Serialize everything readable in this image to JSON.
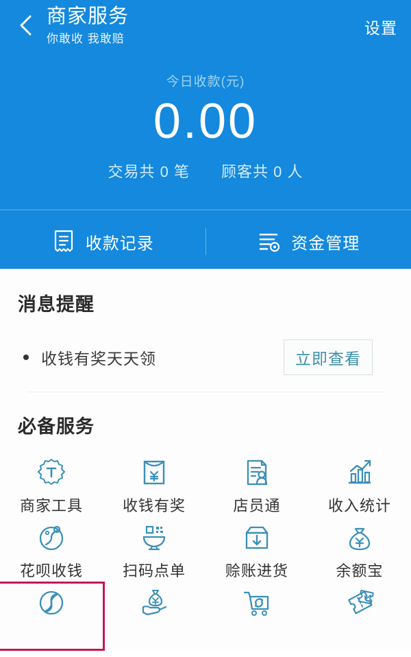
{
  "header": {
    "back_icon": "chevron-left-icon",
    "title": "商家服务",
    "subtitle": "你敢收 我敢赔",
    "settings_label": "设置"
  },
  "summary": {
    "label": "今日收款(元)",
    "amount": "0.00",
    "stats": [
      {
        "text": "交易共 0 笔"
      },
      {
        "text": "顾客共 0 人"
      }
    ]
  },
  "tabs": [
    {
      "label": "收款记录",
      "icon": "receipt-icon"
    },
    {
      "label": "资金管理",
      "icon": "fund-settings-icon"
    }
  ],
  "messages": {
    "heading": "消息提醒",
    "items": [
      {
        "text": "收钱有奖天天领",
        "action_label": "立即查看"
      }
    ]
  },
  "services": {
    "heading": "必备服务",
    "items": [
      {
        "label": "商家工具",
        "icon": "merchant-tool-badge-icon"
      },
      {
        "label": "收钱有奖",
        "icon": "red-envelope-yuan-icon"
      },
      {
        "label": "店员通",
        "icon": "staff-document-icon"
      },
      {
        "label": "收入统计",
        "icon": "bar-chart-trend-icon"
      },
      {
        "label": "花呗收钱",
        "icon": "huabei-icon"
      },
      {
        "label": "扫码点单",
        "icon": "scan-order-bowl-icon"
      },
      {
        "label": "赊账进货",
        "icon": "credit-stock-box-icon"
      },
      {
        "label": "余额宝",
        "icon": "money-bag-yuan-icon"
      },
      {
        "label": "",
        "icon": "mutual-aid-circle-icon"
      },
      {
        "label": "",
        "icon": "hand-money-bag-icon"
      },
      {
        "label": "",
        "icon": "cart-refresh-icon"
      },
      {
        "label": "",
        "icon": "coupon-tickets-icon"
      }
    ],
    "highlighted_index": 8
  },
  "colors": {
    "brand_blue": "#1489dd",
    "icon_blue": "#3a8fb7",
    "highlight_red": "#c2185b",
    "link_teal": "#3d8ea8"
  }
}
